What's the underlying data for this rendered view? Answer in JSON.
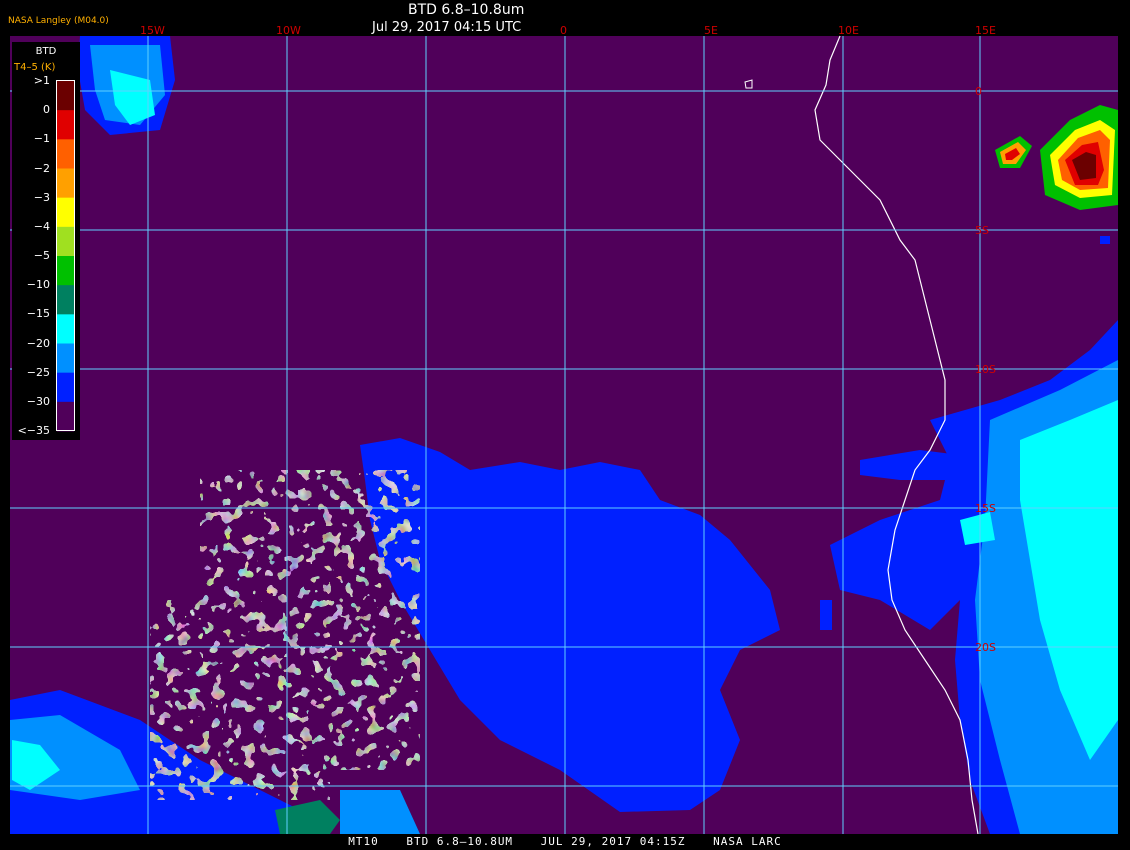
{
  "header": {
    "title": "BTD 6.8–10.8um",
    "timestamp": "Jul 29, 2017 04:15 UTC",
    "agency": "NASA Langley (M04.0)"
  },
  "legend": {
    "title": "BTD",
    "subtitle": "T4–5 (K)",
    "labels": [
      ">1",
      "0",
      "−1",
      "−2",
      "−3",
      "−4",
      "−5",
      "−10",
      "−15",
      "−20",
      "−25",
      "−30",
      "<−35"
    ],
    "colors": [
      "#6b0000",
      "#e00000",
      "#ff6000",
      "#ffa000",
      "#ffff00",
      "#a0e020",
      "#00c000",
      "#008060",
      "#00ffff",
      "#0090ff",
      "#0020ff",
      "#50005a"
    ]
  },
  "lon_labels": [
    "15W",
    "10W",
    "0",
    "5E",
    "10E",
    "15E"
  ],
  "lat_labels": [
    "0",
    "5S",
    "10S",
    "15S",
    "20S"
  ],
  "footer": {
    "satellite": "MT10",
    "product": "BTD 6.8–10.8UM",
    "date": "JUL 29, 2017 04:15Z",
    "org": "NASA LARC"
  },
  "colors": {
    "background": "#50005a",
    "grid": "#60d0ff",
    "grid_label": "#d00000",
    "coastline": "#ffffff"
  }
}
